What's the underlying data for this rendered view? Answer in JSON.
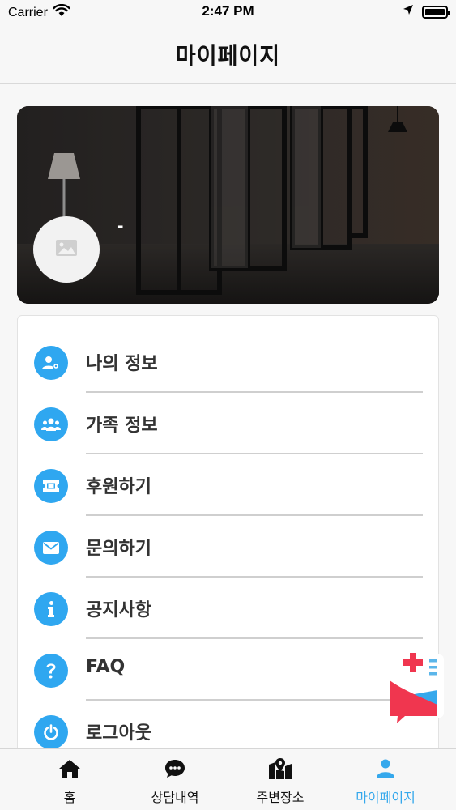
{
  "status_bar": {
    "carrier": "Carrier",
    "time": "2:47 PM"
  },
  "nav": {
    "title": "마이페이지"
  },
  "profile": {
    "name": "-",
    "avatar_icon": "image-placeholder-icon"
  },
  "menu": {
    "items": [
      {
        "label": "나의 정보",
        "icon": "user-gear-icon"
      },
      {
        "label": "가족 정보",
        "icon": "users-icon"
      },
      {
        "label": "후원하기",
        "icon": "ticket-icon"
      },
      {
        "label": "문의하기",
        "icon": "envelope-icon"
      },
      {
        "label": "공지사항",
        "icon": "info-icon"
      },
      {
        "label": "FAQ",
        "icon": "question-icon"
      },
      {
        "label": "로그아웃",
        "icon": "power-icon"
      }
    ]
  },
  "tabs": [
    {
      "label": "홈",
      "icon": "home-icon",
      "active": false
    },
    {
      "label": "상담내역",
      "icon": "comment-dots-icon",
      "active": false
    },
    {
      "label": "주변장소",
      "icon": "map-marker-icon",
      "active": false
    },
    {
      "label": "마이페이지",
      "icon": "user-icon",
      "active": true
    }
  ],
  "colors": {
    "accent": "#2fa7f0",
    "active_tab": "#35a8ec",
    "badge_red": "#f0364f"
  }
}
